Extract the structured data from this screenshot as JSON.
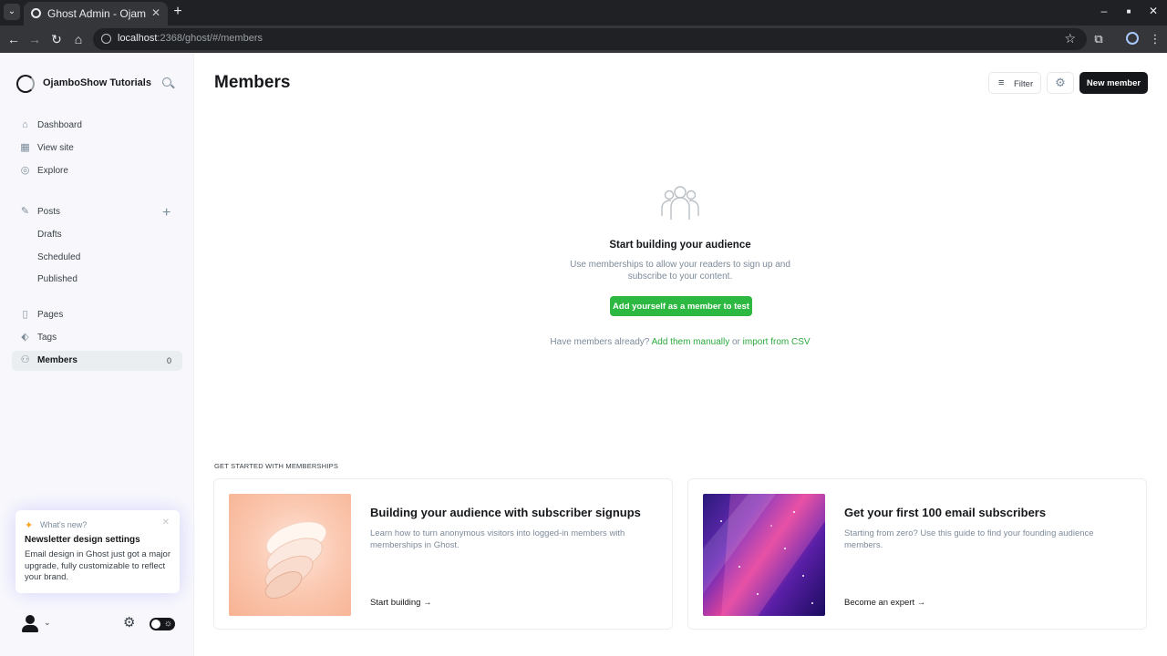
{
  "browser": {
    "tab_title": "Ghost Admin - OjamboShow Tutorials",
    "url_host": "localhost",
    "url_rest": ":2368/ghost/#/members"
  },
  "sidebar": {
    "site_name": "OjamboShow Tutorials",
    "nav": [
      {
        "label": "Dashboard",
        "icon": "home-icon"
      },
      {
        "label": "View site",
        "icon": "layout-icon"
      },
      {
        "label": "Explore",
        "icon": "globe-icon"
      }
    ],
    "posts": {
      "label": "Posts",
      "sub": [
        "Drafts",
        "Scheduled",
        "Published"
      ]
    },
    "content": [
      {
        "label": "Pages",
        "icon": "page-icon"
      },
      {
        "label": "Tags",
        "icon": "tag-icon"
      },
      {
        "label": "Members",
        "icon": "members-icon",
        "count": "0",
        "active": true
      }
    ],
    "whats_new": {
      "kicker": "What's new?",
      "headline": "Newsletter design settings",
      "body": "Email design in Ghost just got a major upgrade, fully customizable to reflect your brand."
    }
  },
  "main": {
    "title": "Members",
    "filter_label": "Filter",
    "new_member_label": "New member",
    "empty_state": {
      "title": "Start building your audience",
      "description": "Use memberships to allow your readers to sign up and subscribe to your content.",
      "cta": "Add yourself as a member to test",
      "have_members_text": "Have members already?",
      "add_manually": "Add them manually",
      "or_text": "or",
      "import_csv": "import from CSV"
    },
    "get_started_label": "GET STARTED WITH MEMBERSHIPS",
    "cards": [
      {
        "title": "Building your audience with subscriber signups",
        "description": "Learn how to turn anonymous visitors into logged-in members with memberships in Ghost.",
        "link": "Start building →"
      },
      {
        "title": "Get your first 100 email subscribers",
        "description": "Starting from zero? Use this guide to find your founding audience members.",
        "link": "Become an expert →"
      }
    ]
  },
  "colors": {
    "accent_green": "#2cb841",
    "dark": "#15171a",
    "sidebar_bg": "#f8f8fc"
  }
}
